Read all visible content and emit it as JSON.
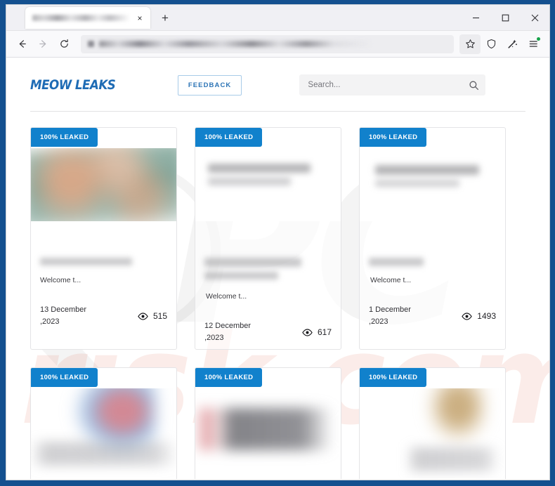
{
  "browser": {
    "tab": {
      "title_blurred": true,
      "close_label": "×"
    },
    "new_tab_label": "+",
    "window_controls": {
      "minimize": "minimize-icon",
      "maximize": "maximize-icon",
      "close": "close-icon"
    },
    "nav": {
      "back": "back-arrow-icon",
      "forward": "forward-arrow-icon",
      "reload": "reload-icon"
    },
    "url_blurred": true,
    "toolbar_icons": [
      "bookmark-star-icon",
      "shield-icon",
      "sparkle-wand-icon",
      "app-menu-icon"
    ]
  },
  "site": {
    "logo": "MEOW LEAKS",
    "feedback_label": "FEEDBACK",
    "search": {
      "value": "",
      "placeholder": "Search..."
    }
  },
  "cards": [
    {
      "badge": "100% LEAKED",
      "excerpt": "Welcome t...",
      "date": "13 December\n,2023",
      "views": "515",
      "media": "photo-green",
      "translucent": false
    },
    {
      "badge": "100% LEAKED",
      "excerpt": "Welcome t...",
      "date": "12 December\n,2023",
      "views": "617",
      "media": "document-grey",
      "translucent": true
    },
    {
      "badge": "100% LEAKED",
      "excerpt": "Welcome t...",
      "date": "1 December\n,2023",
      "views": "1493",
      "media": "document-grey",
      "translucent": true
    }
  ],
  "cards_row2": [
    {
      "badge": "100% LEAKED",
      "media": "blue-red-thumb"
    },
    {
      "badge": "100% LEAKED",
      "media": "red-grey-band"
    },
    {
      "badge": "100% LEAKED",
      "media": "tan-thumb"
    }
  ],
  "watermark": {
    "mark": "PC",
    "domain": "risk.com",
    "color": "#e07052"
  },
  "colors": {
    "window_border": "#14508f",
    "badge_blue": "#1181cc",
    "logo_blue": "#1f6cb5",
    "feedback_border": "#a8cbe8"
  }
}
